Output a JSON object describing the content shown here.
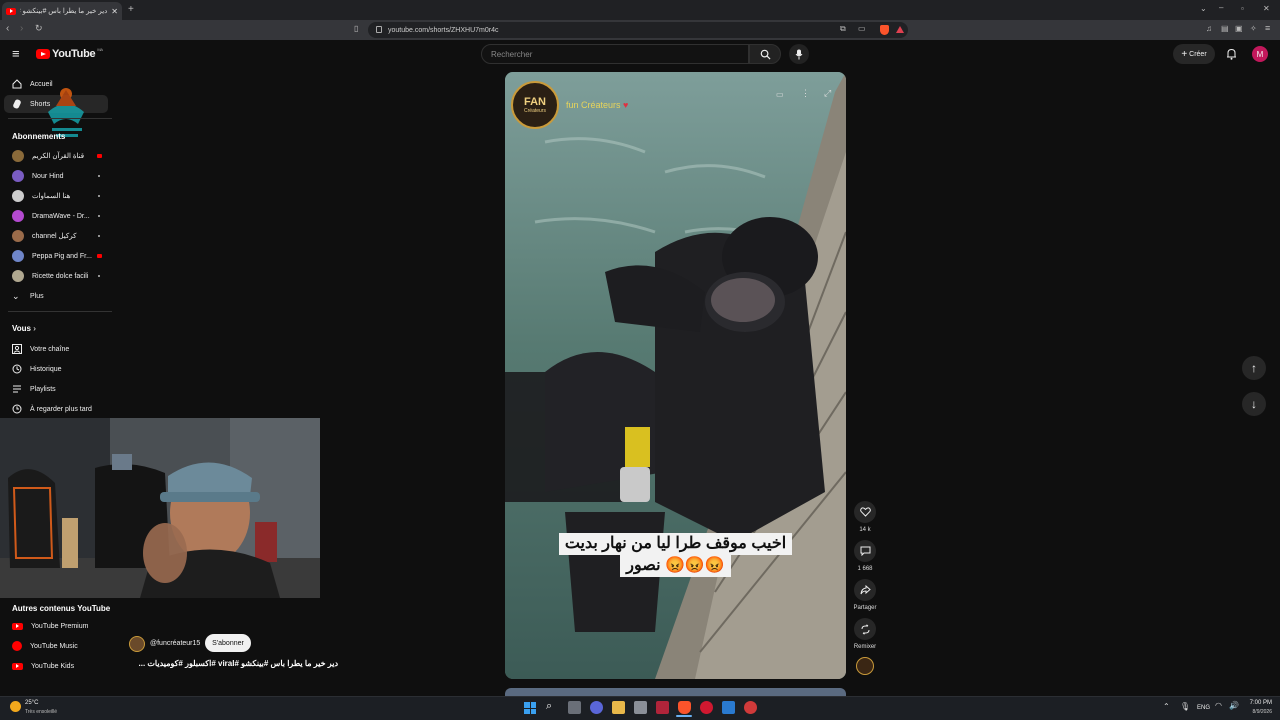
{
  "browser": {
    "tab_title": "دير خير ما يطرا باس #بينكشو #viral",
    "url": "youtube.com/shorts/ZHXHU7m0r4c"
  },
  "header": {
    "logo_text": "YouTube",
    "logo_country": "MA",
    "search_placeholder": "Rechercher",
    "create_label": "Créer",
    "avatar_letter": "M"
  },
  "sidebar": {
    "main": [
      {
        "label": "Accueil"
      },
      {
        "label": "Shorts"
      }
    ],
    "subscriptions_heading": "Abonnements",
    "subscriptions": [
      {
        "label": "قناة القرآن الكريم",
        "color": "#8a6a3a"
      },
      {
        "label": "Nour Hind",
        "color": "#7a5cc2"
      },
      {
        "label": "هنا السماوات",
        "color": "#cccccc"
      },
      {
        "label": "DramaWave - Dr...",
        "color": "#b44ad0"
      },
      {
        "label": "channel كركيل",
        "color": "#9a6b4a"
      },
      {
        "label": "Peppa Pig and Fr...",
        "color": "#6f86c9"
      },
      {
        "label": "Ricette dolce facili",
        "color": "#b0a890"
      }
    ],
    "more_label": "Plus",
    "you_heading": "Vous",
    "you_items": [
      {
        "label": "Votre chaîne"
      },
      {
        "label": "Historique"
      },
      {
        "label": "Playlists"
      },
      {
        "label": "À regarder plus tard"
      }
    ],
    "other_heading": "Autres contenus YouTube",
    "other_items": [
      {
        "label": "YouTube Premium"
      },
      {
        "label": "YouTube Music"
      },
      {
        "label": "YouTube Kids"
      }
    ]
  },
  "short": {
    "channel_overlay": "fun Créateurs",
    "badge_text": "FAN",
    "badge_sub": "Créateurs",
    "caption_line1": "اخيب موقف طرا ليا من نهار بديت",
    "caption_line2": "نصور 😡😡😡",
    "channel_handle": "@funcréateur15",
    "subscribe_label": "S'abonner",
    "title": "دير خير ما يطرا باس #بينكشو #viral #اكسبلور #كوميديات ...",
    "likes": "14 k",
    "comments": "1 668",
    "share_label": "Partager",
    "remix_label": "Remixer"
  },
  "taskbar": {
    "weather_temp": "25°C",
    "weather_desc": "Très ensoleillé",
    "lang": "ENG",
    "time": "7:00 PM",
    "date": "8/9/2026"
  }
}
